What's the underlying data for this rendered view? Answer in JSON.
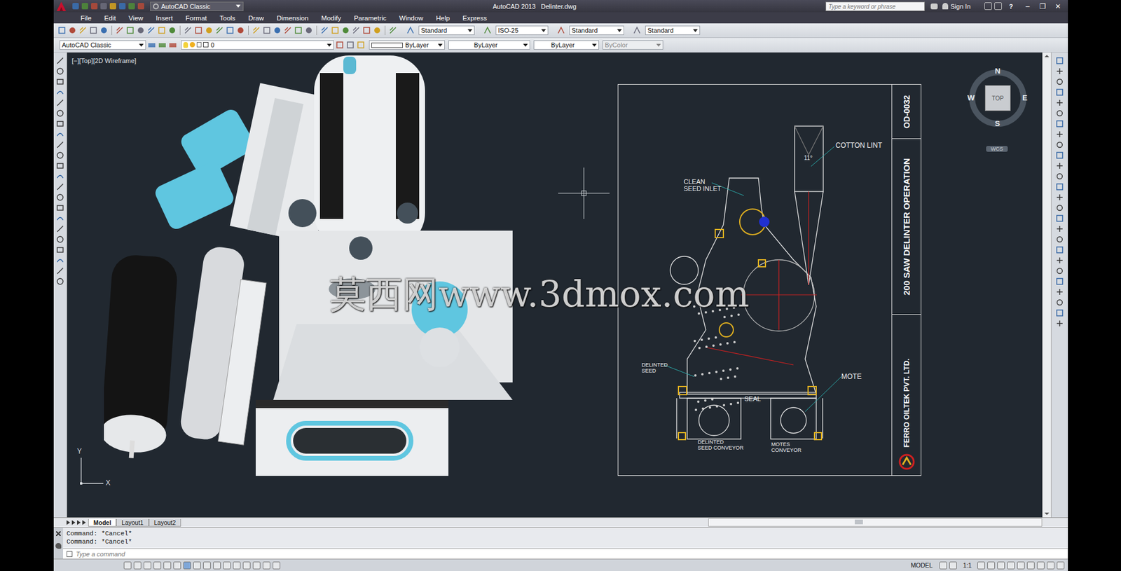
{
  "window": {
    "title": "AutoCAD 2013   Delinter.dwg",
    "workspace": "AutoCAD Classic"
  },
  "search": {
    "placeholder": "Type a keyword or phrase"
  },
  "sign_in": "Sign In",
  "help": "?",
  "window_controls": [
    "–",
    "❐",
    "✕"
  ],
  "menu": [
    "File",
    "Edit",
    "View",
    "Insert",
    "Format",
    "Tools",
    "Draw",
    "Dimension",
    "Modify",
    "Parametric",
    "Window",
    "Help",
    "Express"
  ],
  "style_dropdowns": [
    "Standard",
    "ISO-25",
    "Standard",
    "Standard"
  ],
  "properties": {
    "workspace": "AutoCAD Classic",
    "layer": "0",
    "color": "ByLayer",
    "linetype": "ByLayer",
    "lineweight": "ByLayer",
    "plot_style": "ByColor",
    "plot_style_disabled": true
  },
  "viewport": {
    "label": "[−][Top][2D Wireframe]"
  },
  "viewcube": {
    "n": "N",
    "s": "S",
    "e": "E",
    "w": "W",
    "face": "TOP",
    "ucs": "WCS"
  },
  "ucs_icon": {
    "x": "X",
    "y": "Y"
  },
  "drawing": {
    "number": "OD-0032",
    "title": "200 SAW DELINTER OPERATION",
    "company": "FERRO OILTEK PVT. LTD.",
    "labels": [
      {
        "lines": [
          "COTTON LINT"
        ]
      },
      {
        "lines": [
          "11°"
        ]
      },
      {
        "lines": [
          "CLEAN",
          "SEED INLET"
        ]
      },
      {
        "lines": [
          "DELINTED",
          "SEED"
        ]
      },
      {
        "lines": [
          "MOTE"
        ]
      },
      {
        "lines": [
          "SEAL"
        ]
      },
      {
        "lines": [
          "DELINTED",
          "SEED CONVEYOR"
        ]
      },
      {
        "lines": [
          "MOTES",
          "CONVEYOR"
        ]
      }
    ]
  },
  "watermark": "莫西网www.3dmox.com",
  "layout_tabs": [
    {
      "label": "Model",
      "selected": true
    },
    {
      "label": "Layout1",
      "selected": false
    },
    {
      "label": "Layout2",
      "selected": false
    }
  ],
  "command_history": [
    "Command: *Cancel*",
    "Command: *Cancel*"
  ],
  "command_input": {
    "placeholder": "Type a command"
  },
  "status_bar": {
    "space": "MODEL",
    "scale": "1:1"
  }
}
